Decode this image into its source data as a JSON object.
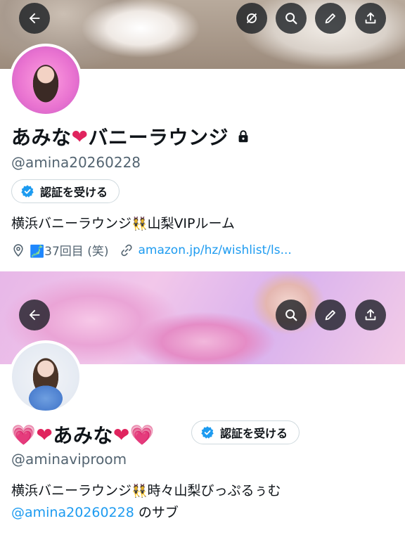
{
  "profile1": {
    "name_prefix": "あみな",
    "name_heart": "❤",
    "name_suffix": "バニーラウンジ",
    "handle": "@amina20260228",
    "verify_label": "認証を受ける",
    "bio_part1": "横浜バニーラウンジ",
    "bio_emoji": "👯",
    "bio_part2": "山梨VIPルーム",
    "meta_location": "🗾37回目 (笑)",
    "meta_link": "amazon.jp/hz/wishlist/ls..."
  },
  "profile2": {
    "name_heart1": "💗",
    "name_heart2": "❤",
    "name_text": "あみな",
    "name_heart3": "❤",
    "name_heart4": "💗",
    "verify_label": "認証を受ける",
    "handle": "@aminaviproom",
    "bio_line1_a": "横浜バニーラウンジ",
    "bio_line1_emoji": "👯",
    "bio_line1_b": "時々山梨びっぷるぅむ",
    "bio_mention": "@amina20260228",
    "bio_line2_suffix": " のサブ"
  },
  "icons": {
    "back": "arrow-left-icon",
    "mute": "mute-icon",
    "search": "search-icon",
    "edit": "pencil-icon",
    "share": "share-icon",
    "lock": "lock-icon",
    "verified": "verified-badge-icon",
    "location": "location-pin-icon",
    "link": "link-icon"
  },
  "colors": {
    "accent": "#1d9bf0",
    "muted_text": "#536471",
    "heart": "#e0245e"
  }
}
